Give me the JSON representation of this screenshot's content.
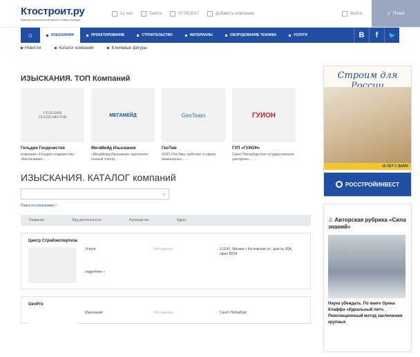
{
  "header": {
    "logo": "Ктостроит.ру",
    "logo_sub": "Единый строительный портал Северо-Запада",
    "items": [
      "12 чел",
      "Газета",
      "07.09.2017",
      "Добавить компанию"
    ],
    "login": "Войти",
    "search": "Поиск"
  },
  "nav": {
    "items": [
      "Изыскания",
      "Проектирование",
      "Строительство",
      "Материалы",
      "Оборудование техника",
      "Услуги"
    ],
    "social": [
      "B",
      "f",
      "🐦"
    ]
  },
  "subnav": [
    "Новости",
    "Каталог компаний",
    "Ключевые фигуры"
  ],
  "top": {
    "title_upper": "Изыскания. Топ",
    "title_lower": "Компаний",
    "cards": [
      {
        "logo": "ГЕЛЬДИЯ ГЕОДЕЗИСТОВ",
        "name": "Гельдия Геодезистов",
        "desc": "Компания «Гельдия геодезистов» обеспечивает... →"
      },
      {
        "logo": "МЕГАМЕЙД",
        "name": "МегаМейд Изыскания",
        "desc": "«МегаМейд Изыскания» выполняет полный спектр... →"
      },
      {
        "logo": "GeoTeam",
        "name": "ГеоТим",
        "desc": "ООО «ГеоТим» работает в сфере инженерных... →"
      },
      {
        "logo": "ГУИОН",
        "name": "ГУП «ГУИОН»",
        "desc": "Санкт-Петербургское государственное унитарное... →"
      }
    ]
  },
  "catalog": {
    "title_upper": "Изыскания. Каталог",
    "title_lower": "компаний",
    "advanced": "Поиск по компаниям ▽",
    "columns": [
      "Название",
      "Вид деятельности",
      "Руководство",
      "Адрес"
    ],
    "entries": [
      {
        "name": "Центр Стройэкспертиза",
        "activity": "Услуги",
        "head": "Нет данных",
        "address": "111141, Москва г. Кусковская ул., дом № 20А, офис В204",
        "more": "подробнее »"
      },
      {
        "name": "GeoPro",
        "activity": "Изыскания",
        "head": "Нет данных",
        "address": "Санкт-Петербург",
        "more": ""
      }
    ]
  },
  "ad": {
    "title": "Строим для России",
    "years": "15 ЛЕТ С ВАМИ",
    "brand": "РОССТРОЙИНВЕСТ"
  },
  "column": {
    "heading": "Авторская рубрика «Сила знаний»",
    "text": "Наука убеждать. По книге Орена Клаффа «Идеальный питч. Революционный метод заключения крупных"
  },
  "colors": {
    "brand": "#1f4ea3",
    "accent": "#c22222"
  }
}
